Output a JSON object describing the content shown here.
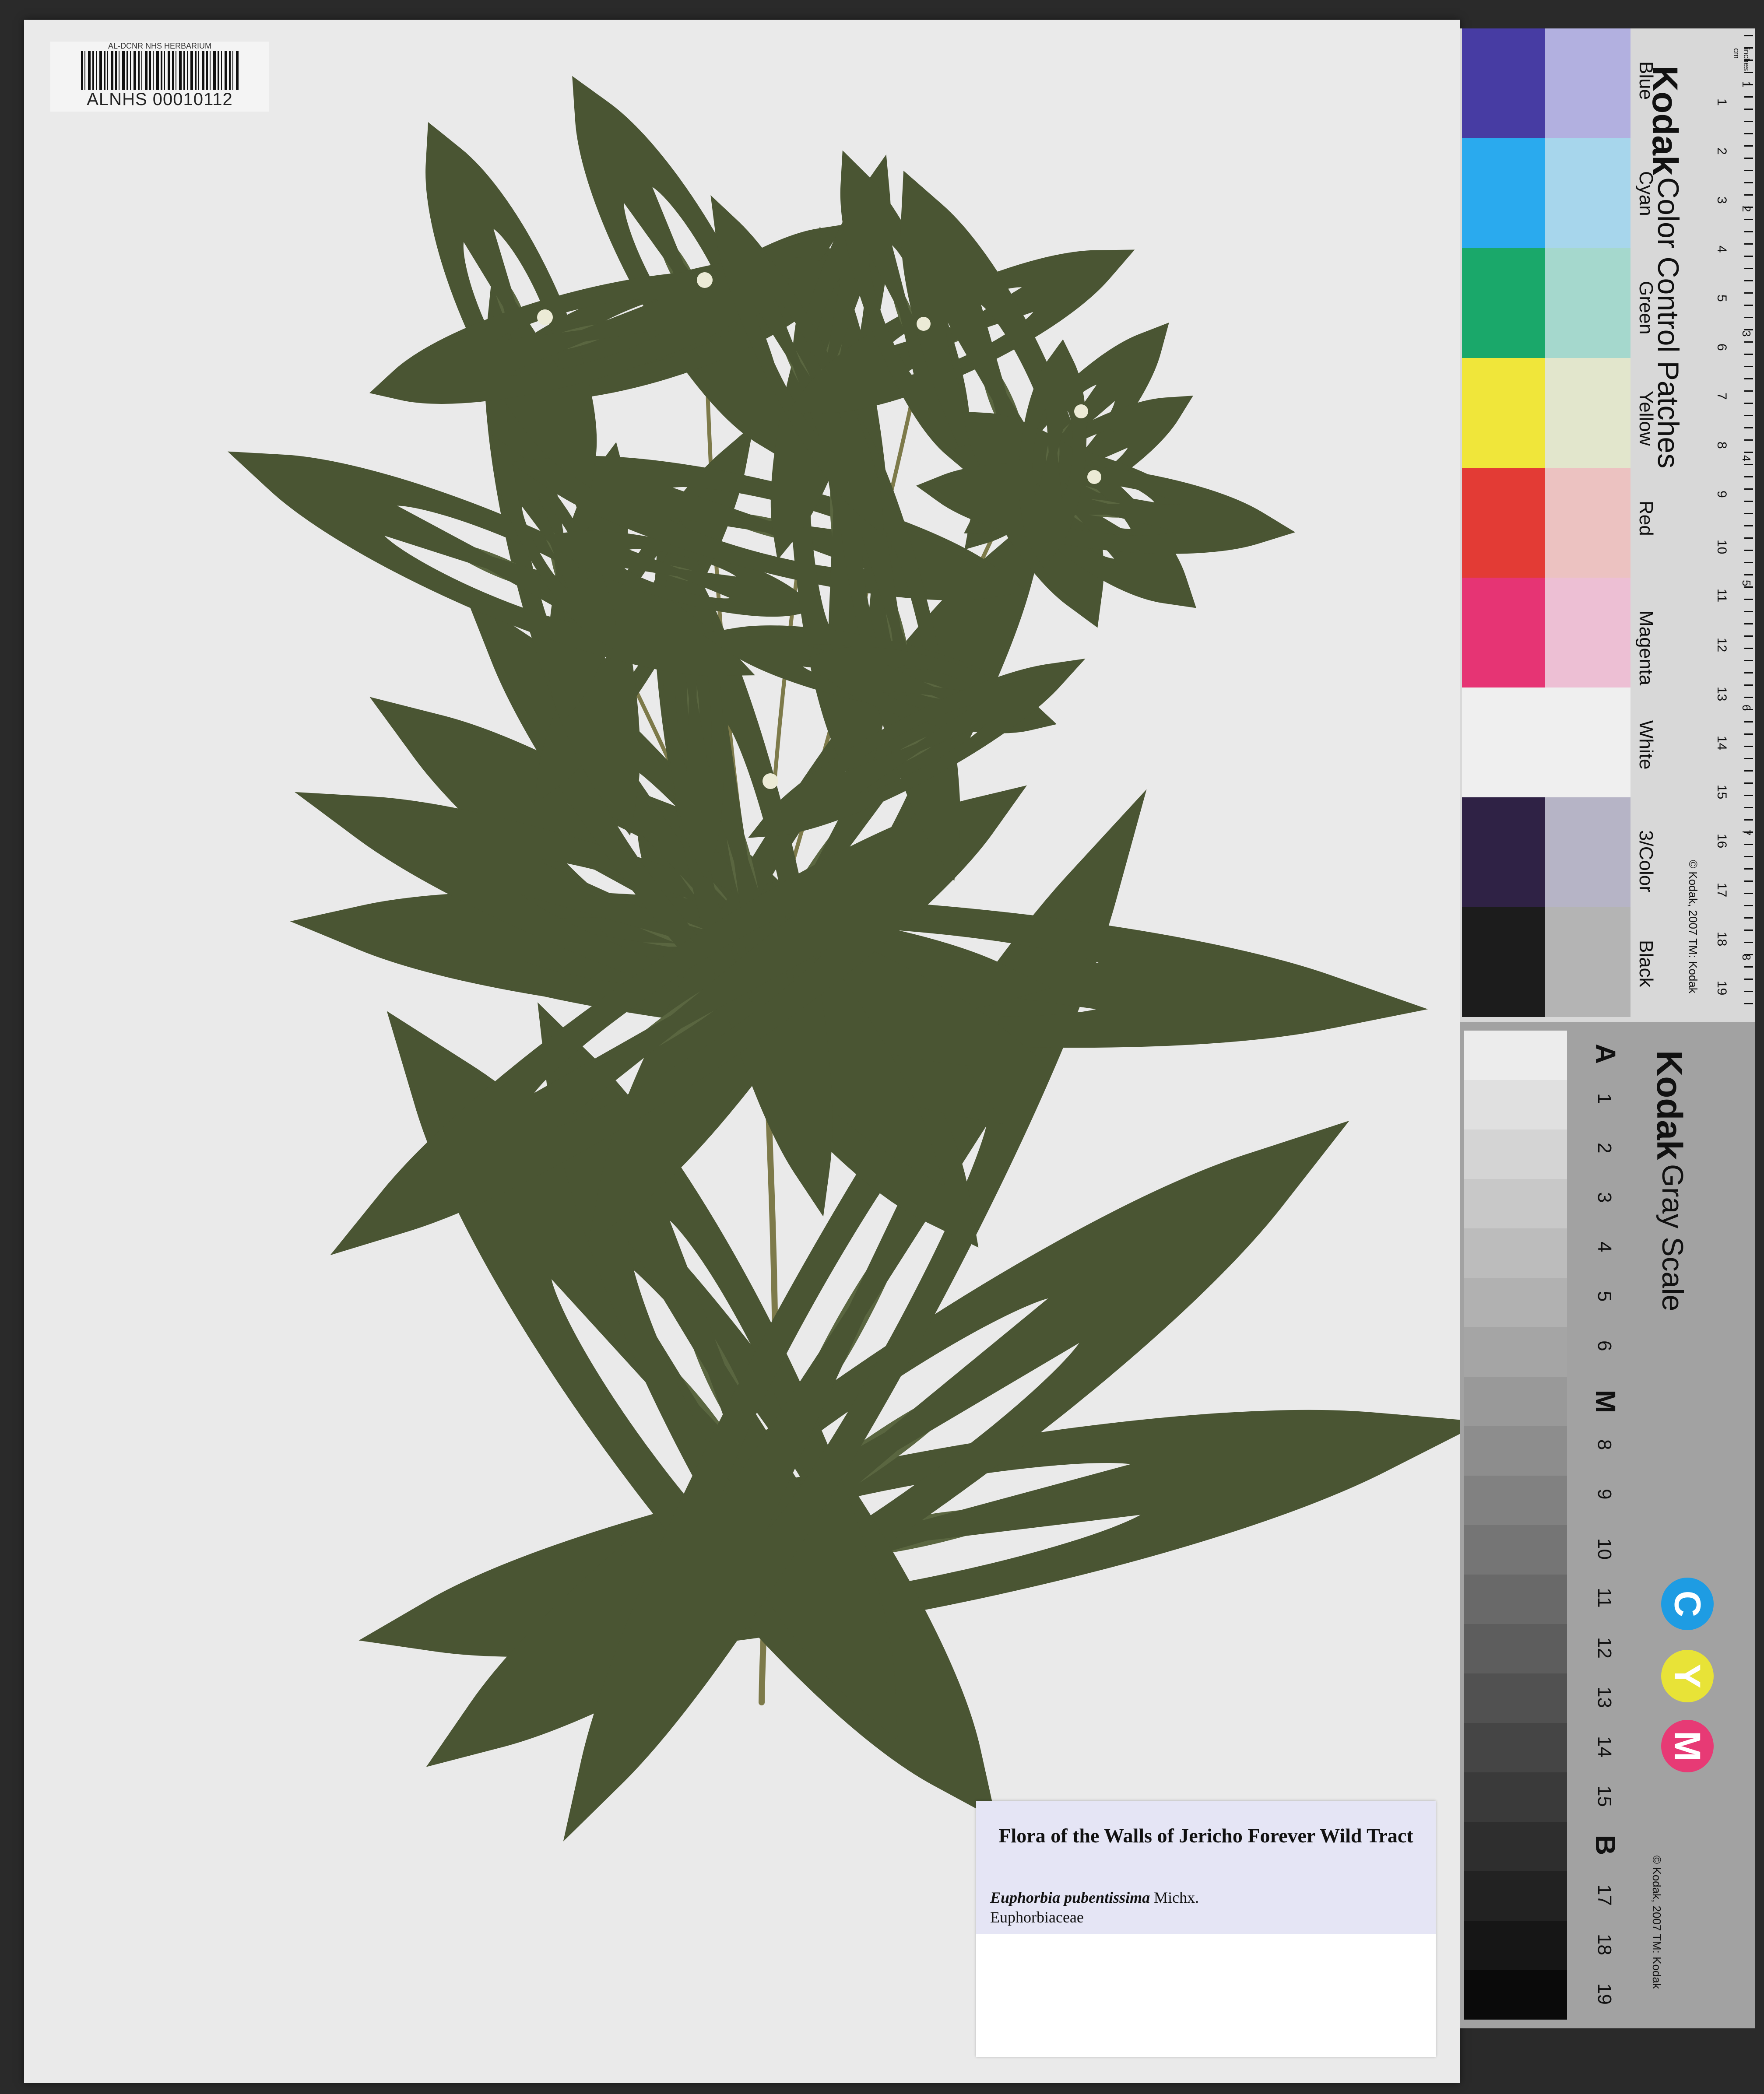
{
  "barcode": {
    "institution": "AL-DCNR NHS HERBARIUM",
    "catalog_number": "ALNHS 00010112"
  },
  "label": {
    "title": "Flora of the Walls of Jericho Forever Wild Tract",
    "species": "Euphorbia pubentissima",
    "author": "Michx.",
    "family": "Euphorbiaceae"
  },
  "color_card": {
    "brand": "Kodak",
    "title": "Color Control Patches",
    "patches": [
      "Blue",
      "Cyan",
      "Green",
      "Yellow",
      "Red",
      "Magenta",
      "White",
      "3/Color",
      "Black"
    ],
    "colors_full": [
      "#473ca3",
      "#2aaaee",
      "#1aa86a",
      "#f0e63a",
      "#e33b35",
      "#e63474",
      "#efefef",
      "#2f2245",
      "#1c1c1c"
    ],
    "colors_tint": [
      "#b2b0e0",
      "#a7d6ec",
      "#a5d8cd",
      "#e2e6cc",
      "#ecc2c1",
      "#edbfd4",
      "#efefef",
      "#b6b4c6",
      "#b4b4b4"
    ],
    "copyright": "© Kodak, 2007 TM: Kodak",
    "unit_cm": "cm",
    "unit_inches": "inches",
    "cm_ticks": [
      "1",
      "2",
      "3",
      "4",
      "5",
      "6",
      "7",
      "8",
      "9",
      "10",
      "11",
      "12",
      "13",
      "14",
      "15",
      "16",
      "17",
      "18",
      "19"
    ],
    "inch_ticks": [
      "1",
      "2",
      "3",
      "4",
      "5",
      "6",
      "7",
      "8"
    ]
  },
  "gray_card": {
    "brand": "Kodak",
    "title": "Gray Scale",
    "steps": [
      "A",
      "1",
      "2",
      "3",
      "4",
      "5",
      "6",
      "M",
      "8",
      "9",
      "10",
      "11",
      "12",
      "13",
      "14",
      "15",
      "B",
      "17",
      "18",
      "19"
    ],
    "cym": [
      "C",
      "Y",
      "M"
    ],
    "copyright": "© Kodak, 2007 TM: Kodak"
  }
}
